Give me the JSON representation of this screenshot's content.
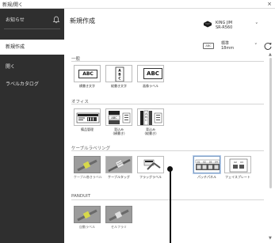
{
  "window": {
    "title": "新規/開く",
    "close_label": "×"
  },
  "sidebar": {
    "items": [
      {
        "label": "お知らせ"
      },
      {
        "label": "新規作成"
      },
      {
        "label": "開く"
      },
      {
        "label": "ラベルカタログ"
      }
    ]
  },
  "main": {
    "title": "新規作成",
    "printer": {
      "line1": "KING JIM",
      "line2": "SR-R560",
      "chevron": "˅"
    },
    "tape": {
      "icon_text": "ABC",
      "line1": "標準",
      "line2": "18mm",
      "chevron": "˅"
    },
    "scrollbar": {
      "up": "▲",
      "down": "▼"
    },
    "sections": [
      {
        "label": "一般",
        "tiles": [
          {
            "caption": "横書き文字"
          },
          {
            "caption": "縦書き文字"
          },
          {
            "caption": "画像ラベル"
          }
        ]
      },
      {
        "label": "オフィス",
        "tiles": [
          {
            "caption": "備品管理"
          },
          {
            "caption": "背込み\n(横書き)"
          },
          {
            "caption": "背込み\n(縦書き)"
          }
        ]
      },
      {
        "label": "ケーブルラベリング",
        "tiles": [
          {
            "caption": "ケーブル巻きラベル"
          },
          {
            "caption": "ケーブルタッグ"
          },
          {
            "caption": "フラッグラベル"
          },
          {
            "caption": "パッチパネル",
            "numbers": [
              "01",
              "02",
              "03",
              "04"
            ]
          },
          {
            "caption": "フェイスプレート",
            "numbers": [
              "02",
              "03"
            ]
          }
        ]
      },
      {
        "label": "PANDUIT",
        "tiles": [
          {
            "caption": "自動ラベル"
          },
          {
            "caption": "セルフラミ"
          }
        ]
      }
    ]
  }
}
